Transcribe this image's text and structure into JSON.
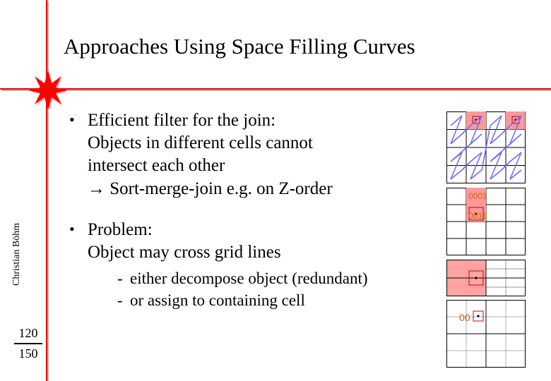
{
  "title": "Approaches Using Space Filling Curves",
  "author": "Christian Böhm",
  "page_current": "120",
  "page_total": "150",
  "bullets": {
    "b1_l1": "Efficient filter for the join:",
    "b1_l2": "Objects in different cells cannot",
    "b1_l3": "intersect each other",
    "b1_arrow": "→",
    "b1_l4": " Sort-merge-join e.g. on Z-order",
    "b2_l1": "Problem:",
    "b2_l2": "Object may cross grid lines",
    "sub1": "either decompose object (redundant)",
    "sub2": "or assign to containing cell"
  },
  "figure_labels": {
    "point1": "•",
    "point2": "•",
    "code1": "0001",
    "code2": "0011",
    "code3": "00"
  }
}
